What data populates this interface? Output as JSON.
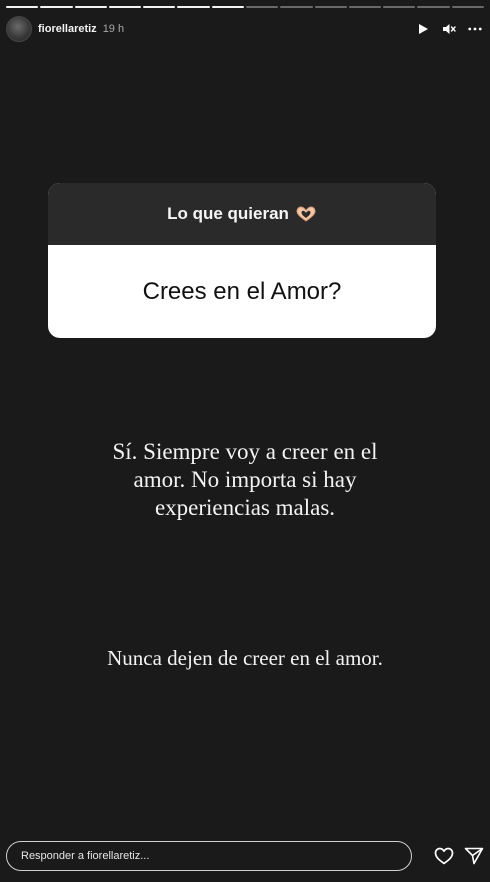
{
  "progress": {
    "total_segments": 14,
    "completed_segments": 7
  },
  "header": {
    "username": "fiorellaretiz",
    "time": "19 h",
    "icons": [
      "play-icon",
      "mute-icon",
      "more-icon"
    ]
  },
  "question_sticker": {
    "title": "Lo que quieran",
    "emoji": "🫶",
    "question": "Crees en el Amor?"
  },
  "answer": {
    "line1": "Sí. Siempre voy a creer en el amor. No importa si hay experiencias malas.",
    "line2": "Nunca dejen de creer en el amor."
  },
  "reply": {
    "placeholder": "Responder a fiorellaretiz...",
    "icons": [
      "heart-icon",
      "send-icon"
    ]
  },
  "colors": {
    "background": "#1a1a1a",
    "card_header": "#2a2a2a",
    "card_body": "#ffffff"
  }
}
